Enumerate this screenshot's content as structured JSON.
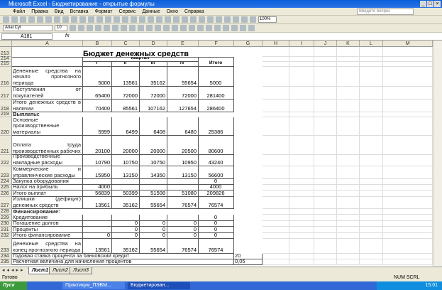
{
  "window": {
    "title": "Microsoft Excel - Бюджетирование - открытые формулы"
  },
  "menu": [
    "Файл",
    "Правка",
    "Вид",
    "Вставка",
    "Формат",
    "Сервис",
    "Данные",
    "Окно",
    "Справка"
  ],
  "ask_placeholder": "Введите вопрос",
  "toolbar": {
    "zoom": "100%",
    "font": "Arial Cyr",
    "size": "10"
  },
  "formula": {
    "name_box": "A181",
    "fx": "fx"
  },
  "columns": [
    "A",
    "B",
    "C",
    "D",
    "E",
    "F",
    "G",
    "H",
    "I",
    "J",
    "K",
    "L",
    "M"
  ],
  "sheet": {
    "title": "Бюджет денежных средств",
    "quarter_label": "квартал",
    "quarters": [
      "I",
      "II",
      "III",
      "IV"
    ],
    "total_label": "Итого",
    "rows": [
      {
        "n": "213"
      },
      {
        "n": "214"
      },
      {
        "n": "215"
      },
      {
        "n": "216",
        "label": "Денежные средства на начало прогнозного периода",
        "v": [
          "5000",
          "13561",
          "35162",
          "55654",
          "5000"
        ]
      },
      {
        "n": "217",
        "label": "Поступления от покупателей",
        "v": [
          "65400",
          "72000",
          "72000",
          "72000",
          "281400"
        ]
      },
      {
        "n": "218",
        "label": "Итого денежных средств в наличии",
        "v": [
          "70400",
          "85561",
          "107162",
          "127654",
          "286400"
        ]
      },
      {
        "n": "219",
        "label": "Выплаты:",
        "bold": true
      },
      {
        "n": "220",
        "label": "Основные производственные материалы",
        "v": [
          "5999",
          "6499",
          "6408",
          "6480",
          "25386"
        ]
      },
      {
        "n": "221",
        "label": "Оплата труда производственных рабочих",
        "v": [
          "20100",
          "20000",
          "20000",
          "20500",
          "80600"
        ]
      },
      {
        "n": "222",
        "label": "Производственные накладные расходы",
        "v": [
          "10790",
          "10750",
          "10750",
          "10950",
          "43240"
        ]
      },
      {
        "n": "223",
        "label": "Коммерческие и управленческие расходы",
        "v": [
          "15950",
          "13150",
          "14350",
          "13150",
          "56600"
        ]
      },
      {
        "n": "224",
        "label": "Закупка оборудования",
        "v": [
          "",
          "",
          "",
          "",
          "0"
        ]
      },
      {
        "n": "225",
        "label": "Налог на прибыль",
        "v": [
          "4000",
          "",
          "",
          "",
          "4000"
        ]
      },
      {
        "n": "226",
        "label": "Итого выплат",
        "v": [
          "56839",
          "50399",
          "51508",
          "51080",
          "209826"
        ]
      },
      {
        "n": "227",
        "label": "Излишки (дефицит) денежных средств",
        "v": [
          "13561",
          "35162",
          "55654",
          "76574",
          "76574"
        ]
      },
      {
        "n": "228",
        "label": "Финансирование:",
        "bold": true
      },
      {
        "n": "229",
        "label": "Кредитование",
        "v": [
          "",
          "",
          "",
          "",
          "0"
        ]
      },
      {
        "n": "230",
        "label": "Погашение долгов",
        "v": [
          "",
          "0",
          "0",
          "0",
          "0"
        ]
      },
      {
        "n": "231",
        "label": "Проценты",
        "v": [
          "",
          "0",
          "0",
          "0",
          "0"
        ]
      },
      {
        "n": "232",
        "label": "Итого финансирование",
        "v": [
          "0",
          "0",
          "0",
          "0",
          "0"
        ]
      },
      {
        "n": "233",
        "label": "Денежные средства на конец прогнозного периода",
        "v": [
          "13561",
          "35162",
          "55654",
          "76574",
          "76574"
        ]
      },
      {
        "n": "234",
        "label": "Годовая ставка процента за банковский кредит",
        "g": "20"
      },
      {
        "n": "235",
        "label": "Расчетная величина для начисления процентов",
        "g": "0,05"
      }
    ]
  },
  "tabs": [
    "Лист1",
    "Лист2",
    "Лист3"
  ],
  "status": {
    "ready": "Готово",
    "indicators": "NUM  SCRL"
  },
  "taskbar": {
    "start": "Пуск",
    "tasks": [
      "Практикум_ПЭВМ...",
      "Бюджетирован..."
    ],
    "clock": "15:01"
  }
}
